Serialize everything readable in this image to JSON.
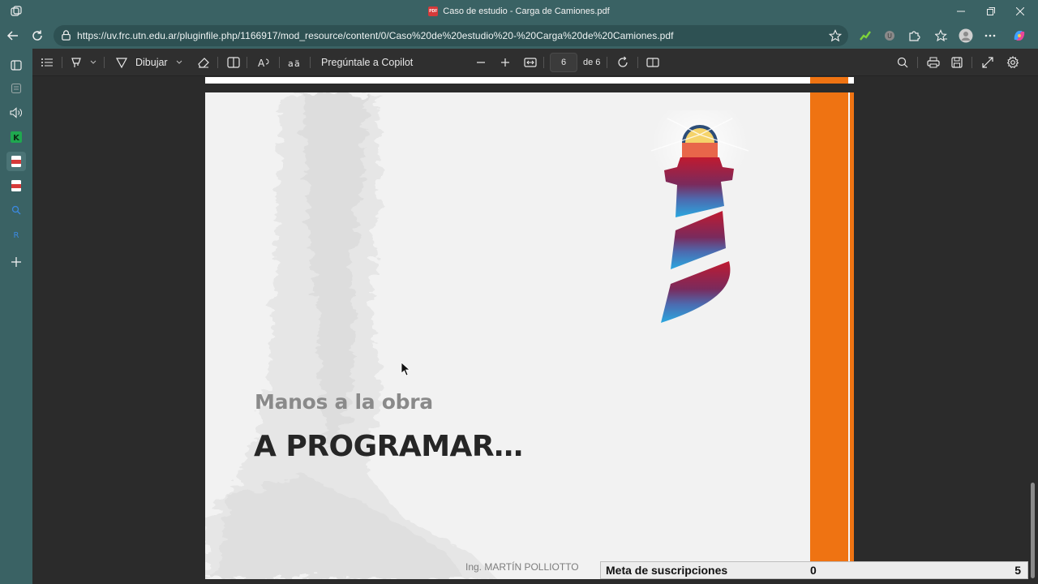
{
  "window": {
    "title": "Caso de estudio - Carga de Camiones.pdf",
    "pdf_badge": "PDF"
  },
  "address_bar": {
    "url": "https://uv.frc.utn.edu.ar/pluginfile.php/1166917/mod_resource/content/0/Caso%20de%20estudio%20-%20Carga%20de%20Camiones.pdf"
  },
  "pdf_toolbar": {
    "draw_label": "Dibujar",
    "copilot_label": "Pregúntale a Copilot",
    "page_current": "6",
    "page_total": "de 6"
  },
  "slide": {
    "subtitle": "Manos a la obra",
    "headline": "A PROGRAMAR…",
    "author": "Ing. MARTÍN POLLIOTTO"
  },
  "meta_widget": {
    "label": "Meta de suscripciones",
    "current": "0",
    "goal": "5"
  },
  "colors": {
    "chrome": "#3a6264",
    "accent_orange": "#ef7312",
    "viewer_bg": "#2b2b2b"
  },
  "icons": {
    "sidebar": [
      "tabs-icon",
      "collections-icon",
      "read-aloud-icon",
      "k-app-icon",
      "pdf-icon",
      "pdf-icon",
      "search-icon",
      "r-app-icon",
      "add-icon"
    ]
  }
}
